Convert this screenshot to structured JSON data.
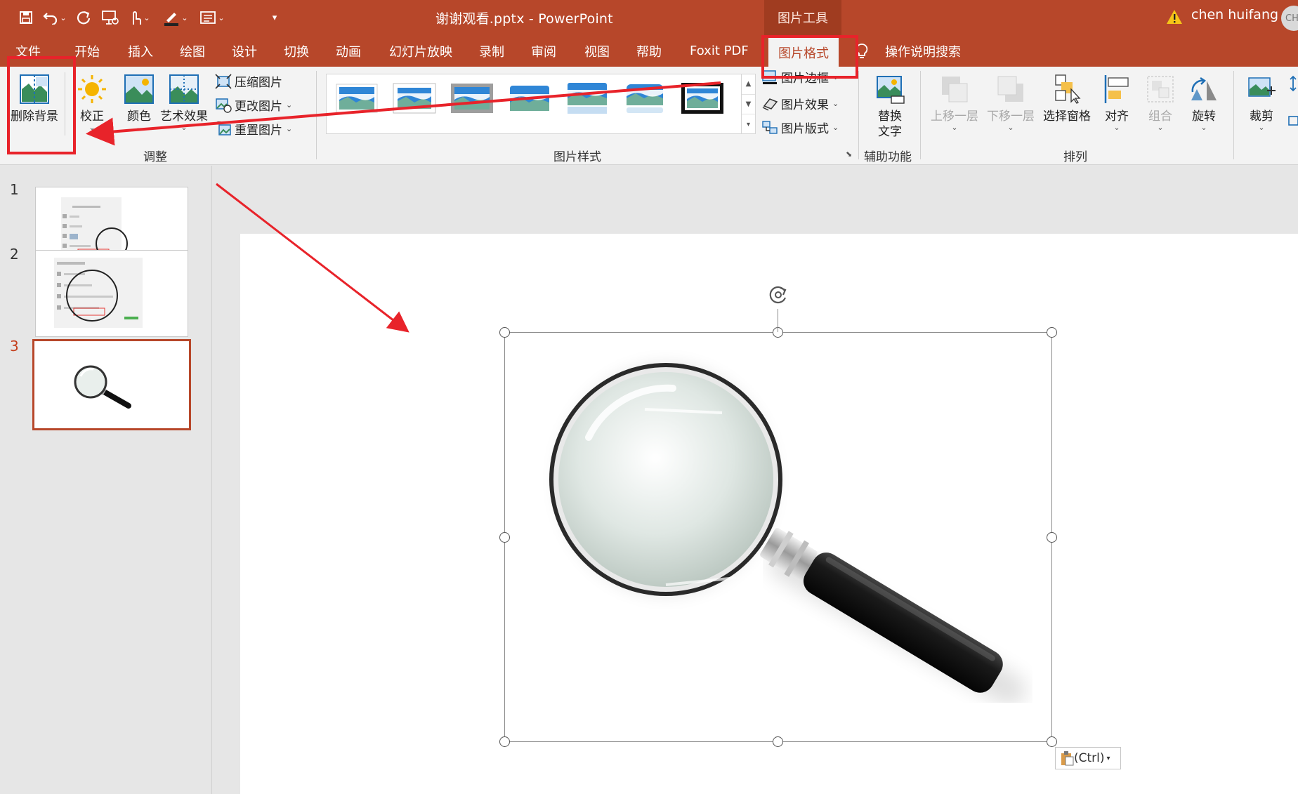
{
  "window": {
    "title": "谢谢观看.pptx - PowerPoint",
    "contextual_tab": "图片工具",
    "user": "chen huifang",
    "avatar_initials": "CH"
  },
  "colors": {
    "brand": "#b7472a",
    "annotation_red": "#e8232a",
    "selected_slide_border": "#b7472a"
  },
  "quick_access": {
    "icons": [
      "save-icon",
      "undo-icon",
      "redo-icon",
      "present-icon",
      "touch-mode-icon",
      "pen-color-icon",
      "layout-icon",
      "customize-caret-icon"
    ]
  },
  "tabs": [
    "文件",
    "开始",
    "插入",
    "绘图",
    "设计",
    "切换",
    "动画",
    "幻灯片放映",
    "录制",
    "审阅",
    "视图",
    "帮助",
    "Foxit PDF",
    "图片格式",
    "操作说明搜索"
  ],
  "active_tab": "图片格式",
  "ribbon": {
    "adjust": {
      "label": "调整",
      "remove_bg": "删除背景",
      "corrections": "校正",
      "color": "颜色",
      "artistic": "艺术效果",
      "compress": "压缩图片",
      "change": "更改图片",
      "reset": "重置图片"
    },
    "styles": {
      "label": "图片样式",
      "border": "图片边框",
      "effects": "图片效果",
      "layout": "图片版式"
    },
    "accessibility": {
      "label": "辅助功能",
      "alt_text_line1": "替换",
      "alt_text_line2": "文字"
    },
    "arrange": {
      "label": "排列",
      "bring_forward": "上移一层",
      "send_backward": "下移一层",
      "selection_pane": "选择窗格",
      "align": "对齐",
      "group": "组合",
      "rotate": "旋转"
    },
    "size": {
      "crop": "裁剪"
    }
  },
  "slides": [
    {
      "number": "1"
    },
    {
      "number": "2"
    },
    {
      "number": "3"
    }
  ],
  "active_slide": "3",
  "paste_options": "(Ctrl)"
}
